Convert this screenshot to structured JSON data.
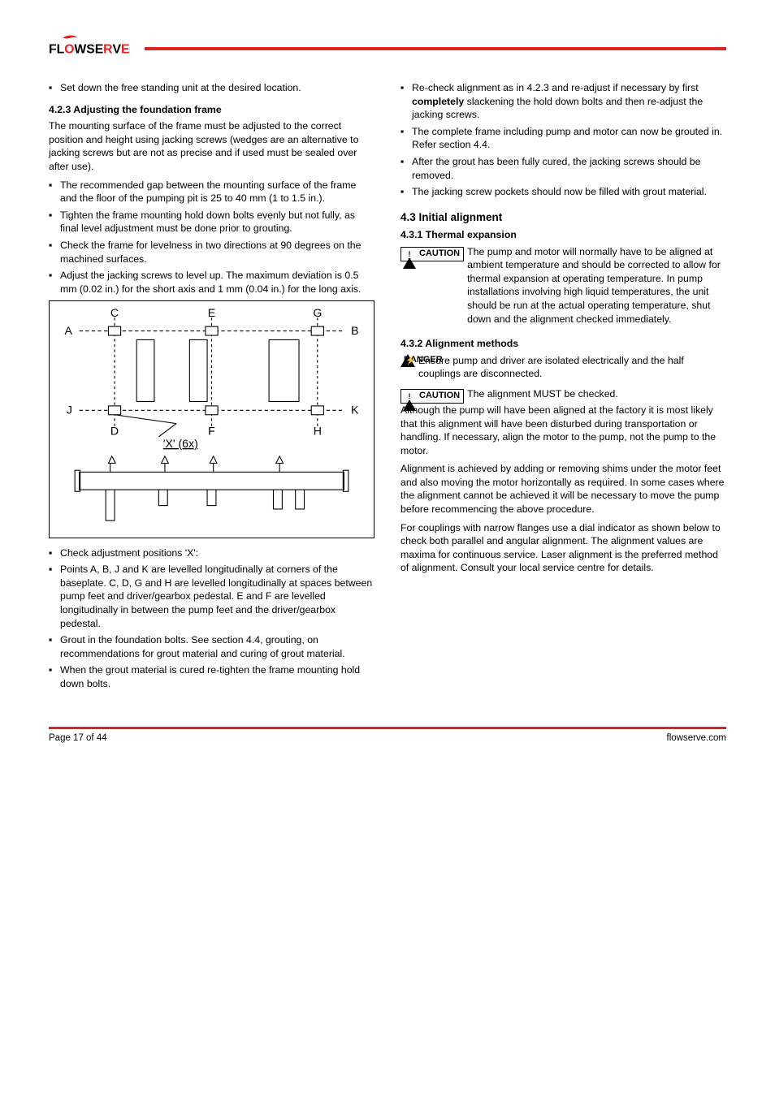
{
  "logo": {
    "name": "Flowserve"
  },
  "left": {
    "bullet0": "Set down the free standing unit at the desired location.",
    "sec_4_2_3_title": "4.2.3    Adjusting the foundation frame",
    "sec_4_2_3_intro": "The mounting surface of the frame must be adjusted to the correct position and height using jacking screws (wedges are an alternative to jacking screws but are not as precise and if used must be sealed over after use).",
    "bullets_a": [
      "The recommended gap between the mounting surface of the frame and the floor of the pumping pit is 25 to 40 mm (1 to 1.5 in.).",
      "Tighten the frame mounting hold down bolts evenly but not fully, as final level adjustment must be done prior to grouting.",
      "Check the frame for levelness in two directions at 90 degrees on the machined surfaces.",
      "Adjust the jacking screws to level up. The maximum deviation is 0.5 mm (0.02 in.) for the short axis and 1 mm (0.04 in.) for the long axis."
    ],
    "bullets_b": [
      "Check adjustment positions 'X':",
      "Points A, B, J and K are levelled longitudinally at corners of the baseplate. C, D, G and H are levelled longitudinally at spaces between pump feet and driver/gearbox pedestal. E and F are levelled longitudinally in between the pump feet and the driver/gearbox pedestal.",
      "Grout in the foundation bolts. See section 4.4, grouting, on recommendations for grout material and curing of grout material.",
      "When the grout material is cured re-tighten the frame mounting hold down bolts."
    ]
  },
  "right": {
    "bullets_a": [
      {
        "text_a": "Re-check alignment as in 4.2.3 and re-adjust if necessary by first ",
        "bold": "completely",
        "text_b": " slackening the hold down bolts and then re-adjust the jacking screws."
      },
      {
        "plain": "The complete frame including pump and motor can now be grouted in. Refer section 4.4."
      },
      {
        "plain": "After the grout has been fully cured, the jacking screws should be removed."
      },
      {
        "plain": "The jacking screw pockets should now be filled with grout material."
      }
    ],
    "h_4_3": "4.3  Initial alignment",
    "h_4_3_1": "4.3.1  Thermal expansion",
    "caution_4_3_1": "The pump and motor will normally have to be aligned at ambient temperature and should be corrected to allow for thermal expansion at operating temperature. In pump installations involving high liquid temperatures, the unit should be run at the actual operating temperature, shut down and the alignment checked immediately.",
    "h_4_3_2": "4.3.2  Alignment methods",
    "danger_4_3_2": "Ensure pump and driver are isolated electrically and the half couplings are disconnected.",
    "caution_4_3_2_a": "The alignment MUST be checked.",
    "caution_4_3_2_b": "Although the pump will have been aligned at the factory it is most likely that this alignment will have been disturbed during transportation or handling. If necessary, align the motor to the pump, not the pump to the motor.",
    "para_align": "Alignment is achieved by adding or removing shims under the motor feet and also moving the motor horizontally as required. In some cases where the alignment cannot be achieved it will be necessary to move the pump before recommencing the above procedure.",
    "para_laser": "For couplings with narrow flanges use a dial indicator as shown below to check both parallel and angular alignment. The alignment values are maxima for continuous service. Laser alignment is the preferred method of alignment. Consult your local service centre for details."
  },
  "labels": {
    "caution": "CAUTION",
    "danger": "DANGER"
  },
  "figure": {
    "letters": {
      "A": "A",
      "B": "B",
      "C": "C",
      "D": "D",
      "E": "E",
      "F": "F",
      "G": "G",
      "H": "H",
      "J": "J",
      "K": "K"
    },
    "x_label": "'X' (6x)"
  },
  "footer": {
    "left": "Page 17 of 44",
    "right": "flowserve.com"
  }
}
